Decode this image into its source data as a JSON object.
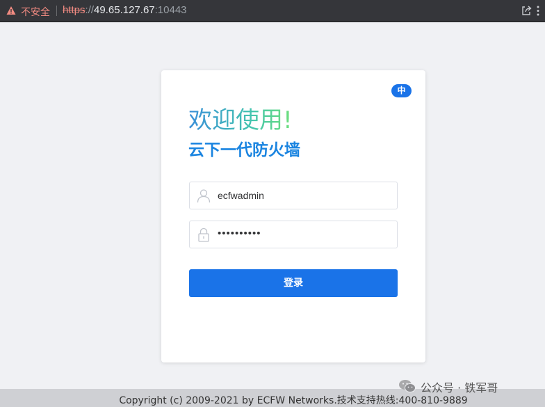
{
  "browser": {
    "security_label": "不安全",
    "url_scheme": "https",
    "url_sep": "://",
    "url_host": "49.65.127.67",
    "url_port": ":10443"
  },
  "login": {
    "language_badge": "中",
    "welcome": "欢迎使用!",
    "product_name": "云下一代防火墙",
    "username_value": "ecfwadmin",
    "password_value": "••••••••••",
    "login_button": "登录"
  },
  "footer": {
    "copyright": "Copyright (c) 2009-2021 by ECFW Networks.技术支持热线:400-810-9889"
  },
  "watermark": {
    "text": "公众号 · 铁军哥"
  },
  "colors": {
    "accent": "#1a73e8",
    "title_blue": "#1a84e0",
    "insecure_red": "#f28b82"
  },
  "icons": [
    "warning-icon",
    "share-icon",
    "menu-icon",
    "user-icon",
    "lock-icon",
    "wechat-icon"
  ]
}
